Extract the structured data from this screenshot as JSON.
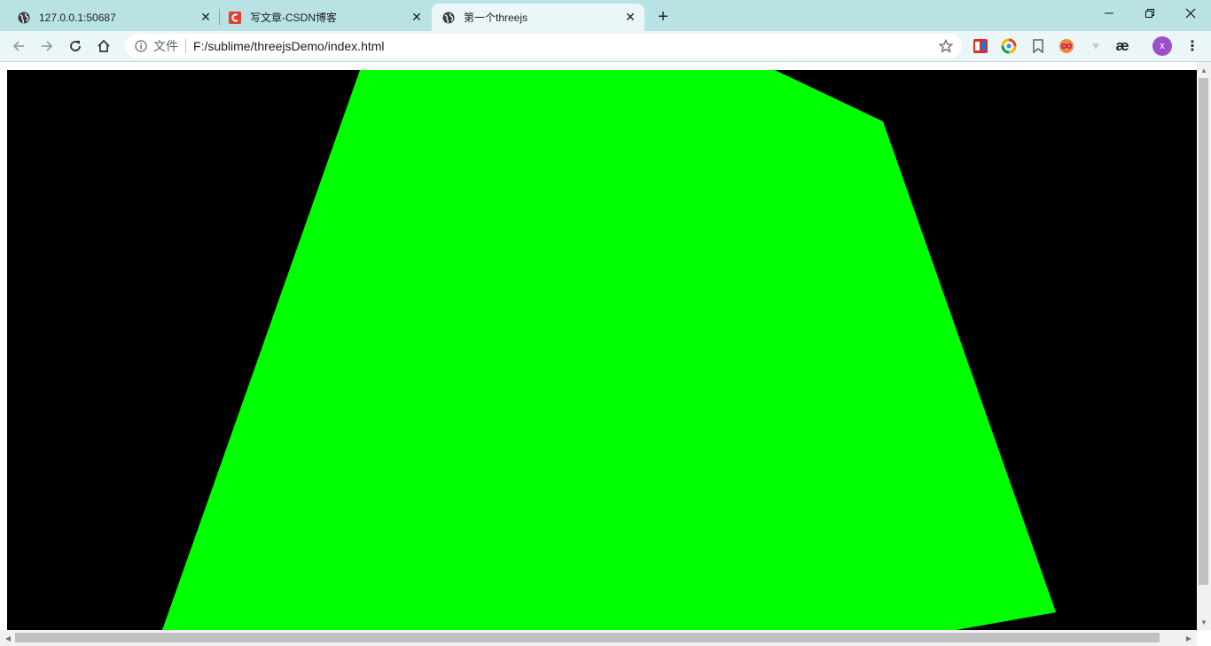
{
  "tabs": [
    {
      "title": "127.0.0.1:50687",
      "icon": "globe-icon"
    },
    {
      "title": "写文章-CSDN博客",
      "icon": "csdn-logo-icon"
    },
    {
      "title": "第一个threejs",
      "icon": "globe-icon"
    }
  ],
  "omnibox": {
    "scheme_label": "文件",
    "url": "F:/sublime/threejsDemo/index.html"
  },
  "profile": {
    "initial": "x",
    "color": "#9c4fc9"
  },
  "extensions": [
    "fe-helper-icon",
    "color-wheel-icon",
    "bookmark-icon",
    "infinity-icon",
    "triangle-icon",
    "ae-icon"
  ],
  "ext_ae_label": "æ",
  "scene": {
    "background": "#000000",
    "mesh_color": "#00ff00"
  },
  "tab_close_glyph": "✕",
  "newtab_glyph": "+",
  "menu_glyph": "⋮"
}
